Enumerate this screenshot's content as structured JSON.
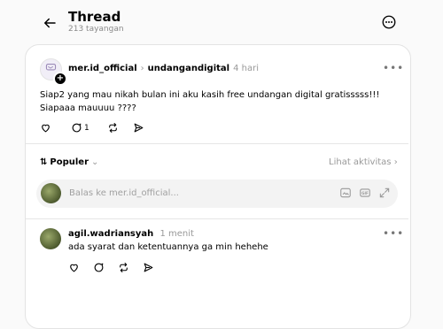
{
  "header": {
    "title": "Thread",
    "views": "213 tayangan"
  },
  "post": {
    "author": "mer.id_official",
    "topic": "undangandigital",
    "time": "4 hari",
    "body_line1": "Siap2 yang mau nikah bulan ini aku kasih free undangan digital gratisssss!!!",
    "body_line2": "Siapaaa mauuuu ????",
    "reply_count": "1"
  },
  "replies_bar": {
    "sort_label": "Populer",
    "activity_link": "Lihat aktivitas"
  },
  "reply_input": {
    "placeholder": "Balas ke mer.id_official..."
  },
  "comment": {
    "author": "agil.wadriansyah",
    "time": "1 menit",
    "body": "ada syarat dan ketentuannya ga min hehehe"
  }
}
